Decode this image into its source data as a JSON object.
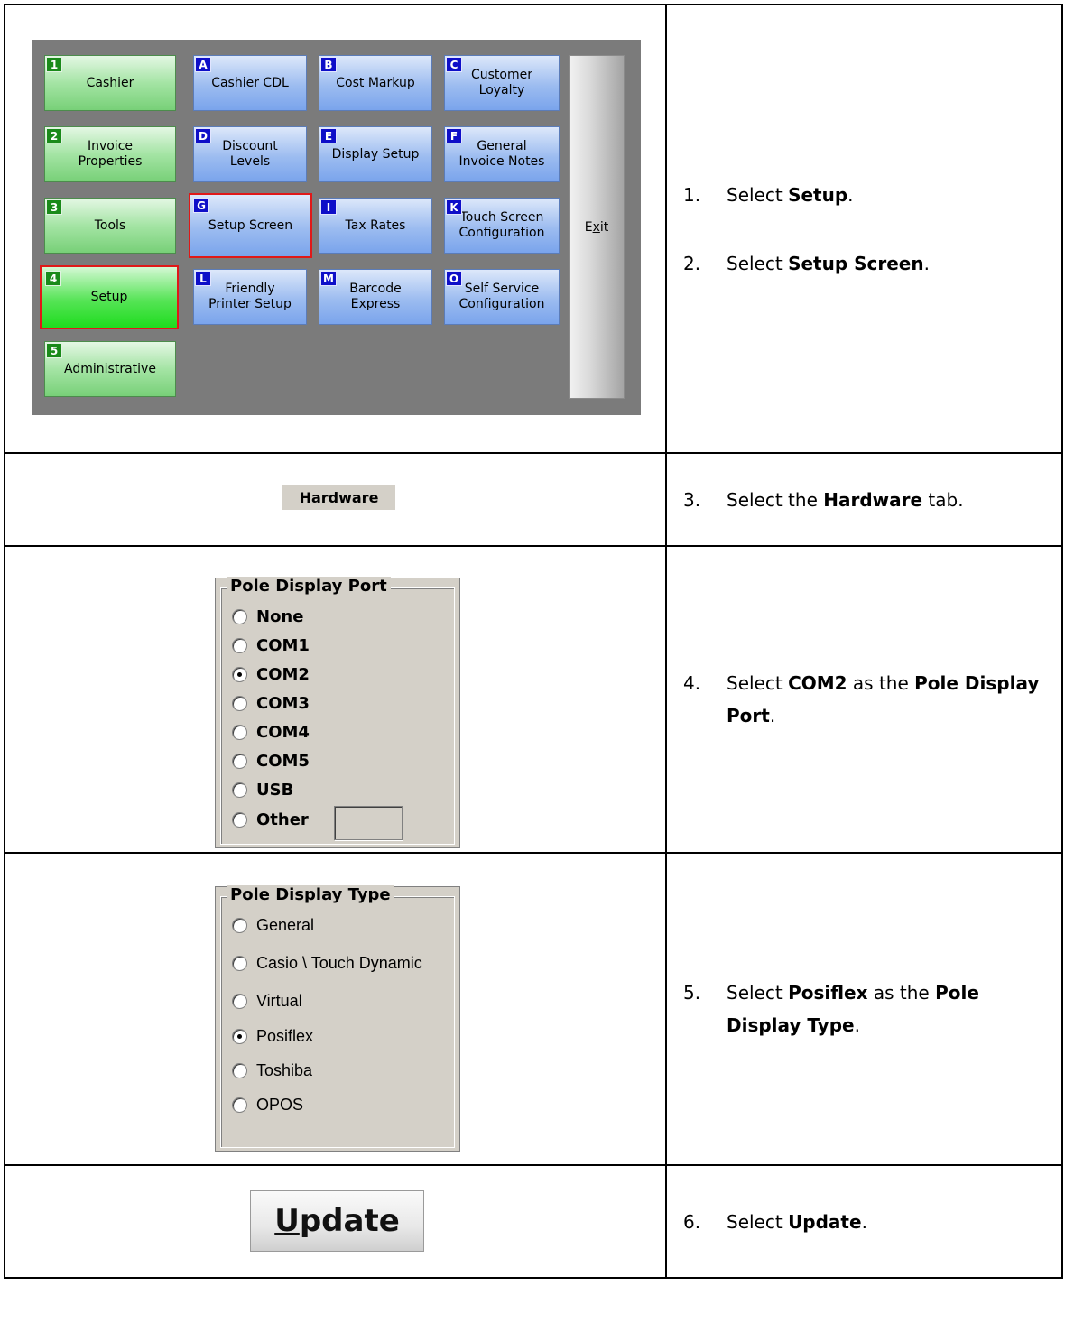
{
  "menu": {
    "left_buttons": [
      {
        "badge": "1",
        "label": "Cashier"
      },
      {
        "badge": "2",
        "label": "Invoice\nProperties"
      },
      {
        "badge": "3",
        "label": "Tools"
      },
      {
        "badge": "4",
        "label": "Setup"
      },
      {
        "badge": "5",
        "label": "Administrative"
      }
    ],
    "grid_buttons": [
      {
        "badge": "A",
        "label": "Cashier CDL"
      },
      {
        "badge": "B",
        "label": "Cost Markup"
      },
      {
        "badge": "C",
        "label": "Customer\nLoyalty"
      },
      {
        "badge": "D",
        "label": "Discount\nLevels"
      },
      {
        "badge": "E",
        "label": "Display Setup"
      },
      {
        "badge": "F",
        "label": "General\nInvoice Notes"
      },
      {
        "badge": "G",
        "label": "Setup Screen"
      },
      {
        "badge": "I",
        "label": "Tax Rates"
      },
      {
        "badge": "K",
        "label": "Touch Screen\nConfiguration"
      },
      {
        "badge": "L",
        "label": "Friendly\nPrinter Setup"
      },
      {
        "badge": "M",
        "label": "Barcode\nExpress"
      },
      {
        "badge": "O",
        "label": "Self Service\nConfiguration"
      }
    ],
    "exit_label": "Exit",
    "exit_mnemonic_pre": "E",
    "exit_mnemonic_char": "x",
    "exit_mnemonic_post": "it"
  },
  "hardware_tab": "Hardware",
  "pole_display_port": {
    "title": "Pole Display Port",
    "options": [
      "None",
      "COM1",
      "COM2",
      "COM3",
      "COM4",
      "COM5",
      "USB",
      "Other"
    ],
    "selected": "COM2"
  },
  "pole_display_type": {
    "title": "Pole Display Type",
    "options": [
      "General",
      "Casio \\ Touch Dynamic",
      "Virtual",
      "Posiflex",
      "Toshiba",
      "OPOS"
    ],
    "selected": "Posiflex"
  },
  "update_button": {
    "u": "U",
    "rest": "pdate"
  },
  "steps": [
    {
      "num": "1.",
      "pre": "Select ",
      "bold": "Setup",
      "post": "."
    },
    {
      "num": "2.",
      "pre": "Select ",
      "bold": "Setup Screen",
      "post": "."
    },
    {
      "num": "3.",
      "pre": "Select the ",
      "bold": "Hardware",
      "post": " tab."
    },
    {
      "num": "4.",
      "pre": "Select ",
      "bold": "COM2",
      "mid": " as the ",
      "bold2": "Pole Display Port",
      "post": "."
    },
    {
      "num": "5.",
      "pre": "Select ",
      "bold": "Posiflex",
      "mid": " as the ",
      "bold2": "Pole Display Type",
      "post": "."
    },
    {
      "num": "6.",
      "pre": "Select ",
      "bold": "Update",
      "post": "."
    }
  ]
}
